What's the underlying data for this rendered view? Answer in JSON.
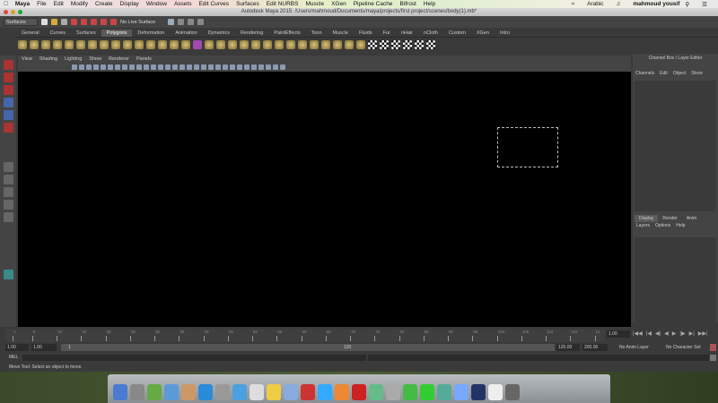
{
  "mac_menu": {
    "items": [
      "Maya",
      "File",
      "Edit",
      "Modify",
      "Create",
      "Display",
      "Window",
      "Assets",
      "Edit Curves",
      "Surfaces",
      "Edit NURBS",
      "Muscle",
      "XGen",
      "Pipeline Cache",
      "Bifrost",
      "Help"
    ],
    "input_source": "Arabic",
    "user": "mahmoud yousif"
  },
  "window_title": "Autodesk Maya 2015: /Users/mahmoud/Documents/maya/projects/first project/scenes/body(1).mb*",
  "status_line": {
    "menu_set": "Surfaces",
    "live_surface": "No Live Surface"
  },
  "shelf_tabs": [
    "General",
    "Curves",
    "Surfaces",
    "Polygons",
    "Deformation",
    "Animation",
    "Dynamics",
    "Rendering",
    "PaintEffects",
    "Toon",
    "Muscle",
    "Fluids",
    "Fur",
    "nHair",
    "nCloth",
    "Custom",
    "XGen",
    "Intro"
  ],
  "active_shelf": "Polygons",
  "panel_menu": [
    "View",
    "Shading",
    "Lighting",
    "Show",
    "Renderer",
    "Panels"
  ],
  "channel_box": {
    "title": "Channel Box / Layer Editor",
    "menu": [
      "Channels",
      "Edit",
      "Object",
      "Show"
    ]
  },
  "layer_editor": {
    "tabs": [
      "Display",
      "Render",
      "Anim"
    ],
    "active": "Display",
    "menu": [
      "Layers",
      "Options",
      "Help"
    ]
  },
  "time_slider": {
    "ticks": [
      "1",
      "5",
      "10",
      "15",
      "20",
      "25",
      "30",
      "35",
      "40",
      "45",
      "50",
      "55",
      "60",
      "65",
      "70",
      "75",
      "80",
      "85",
      "90",
      "95",
      "100",
      "105",
      "110",
      "115",
      "12"
    ],
    "current_frame": "1.00"
  },
  "range_slider": {
    "start": "1.00",
    "playback_start": "1.00",
    "range_start": "1",
    "range_end": "120",
    "playback_end": "120.00",
    "end": "200.00",
    "anim_layer": "No Anim Layer",
    "character_set": "No Character Set"
  },
  "command_line": {
    "label": "MEL"
  },
  "help_line": "Move Tool: Select an object to move.",
  "playback_icons": [
    "go-start-icon",
    "step-back-key-icon",
    "step-back-icon",
    "play-back-icon",
    "play-forward-icon",
    "step-forward-icon",
    "step-forward-key-icon",
    "go-end-icon"
  ]
}
